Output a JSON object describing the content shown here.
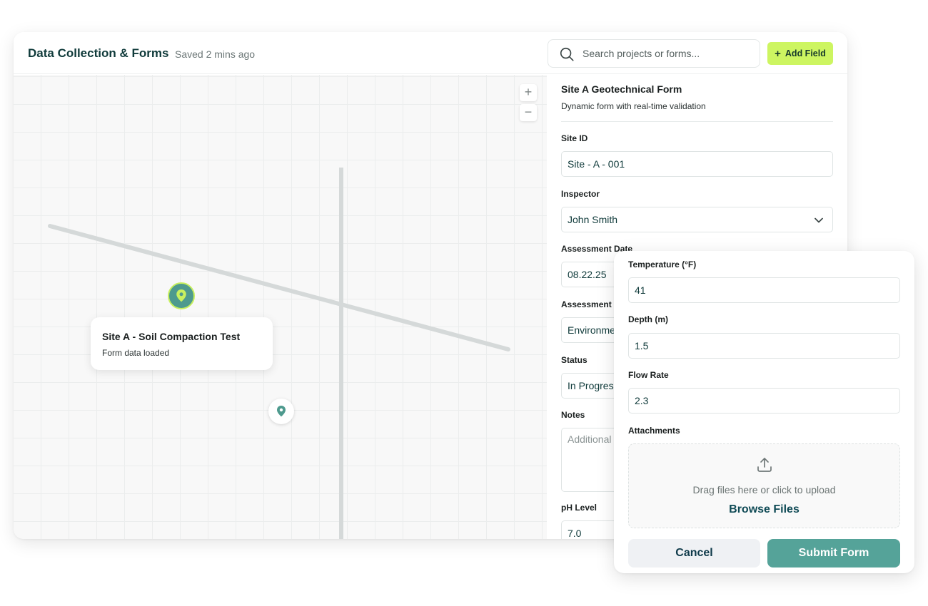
{
  "header": {
    "title": "Data Collection & Forms",
    "saved_status": "Saved 2 mins ago",
    "search_placeholder": "Search projects or forms...",
    "add_field_label": "Add Field",
    "accent_color": "#cdf561"
  },
  "map": {
    "zoom_in": "+",
    "zoom_out": "−",
    "popup": {
      "title": "Site A - Soil Compaction Test",
      "subtitle": "Form data loaded"
    }
  },
  "form": {
    "title": "Site A Geotechnical Form",
    "subtitle": "Dynamic form with real-time validation",
    "fields": [
      {
        "label": "Site ID",
        "value": "Site - A - 001"
      },
      {
        "label": "Inspector",
        "value": "John Smith"
      },
      {
        "label": "Assessment Date",
        "value": "08.22.25"
      },
      {
        "label": "Assessment C",
        "value": "Environme"
      },
      {
        "label": "Status",
        "value": "In Progress"
      },
      {
        "label": "Notes",
        "value": "Additional"
      },
      {
        "label": "pH Level",
        "value": "7.0"
      }
    ]
  },
  "floating_card": {
    "fields": [
      {
        "label": "Temperature (°F)",
        "value": "41"
      },
      {
        "label": "Depth (m)",
        "value": "1.5"
      },
      {
        "label": "Flow Rate",
        "value": "2.3"
      }
    ],
    "attachments_label": "Attachments",
    "upload_text": "Drag files here or click to upload",
    "browse_label": "Browse Files",
    "cancel_label": "Cancel",
    "submit_label": "Submit Form",
    "submit_color": "#55a399"
  }
}
